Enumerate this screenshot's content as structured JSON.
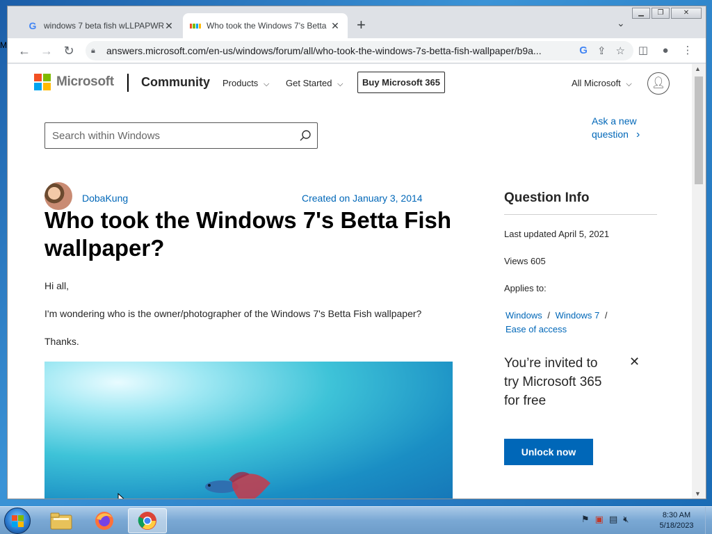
{
  "desktop": {
    "letter": "M"
  },
  "browser": {
    "tabs": [
      {
        "title": "windows 7 beta fish wLLPAPWR",
        "icon": "google-icon"
      },
      {
        "title": "Who took the Windows 7's Betta",
        "icon": "microsoft-icon"
      }
    ],
    "new_tab": "+",
    "address": "answers.microsoft.com/en-us/windows/forum/all/who-took-the-windows-7s-betta-fish-wallpaper/b9a..."
  },
  "site": {
    "brand": "Microsoft",
    "community": "Community",
    "nav": {
      "products": "Products",
      "get_started": "Get Started",
      "chevron": "⌵"
    },
    "buy_button": "Buy Microsoft 365",
    "all_microsoft": "All Microsoft",
    "search_placeholder": "Search within Windows",
    "ask_question": "Ask a new question"
  },
  "question": {
    "author": "DobaKung",
    "created": "Created on January 3, 2014",
    "title": "Who took the Windows 7's Betta Fish wallpaper?",
    "greeting": "Hi all,",
    "body": "I'm wondering who is the owner/photographer of the Windows 7's Betta Fish wallpaper?",
    "closing": "Thanks."
  },
  "sidebar": {
    "heading": "Question Info",
    "last_updated": "Last updated April 5, 2021",
    "views": "Views 605",
    "applies_to": "Applies to:",
    "links": [
      "Windows",
      "Windows 7",
      "Ease of access"
    ],
    "separator": "/",
    "promo": "You’re invited to try Microsoft 365 for free",
    "unlock_button": "Unlock now"
  },
  "taskbar": {
    "time": "8:30 AM",
    "date": "5/18/2023"
  },
  "colors": {
    "link": "#0067b8",
    "ms_red": "#f25022",
    "ms_green": "#7fba00",
    "ms_blue": "#00a4ef",
    "ms_yellow": "#ffb900"
  }
}
